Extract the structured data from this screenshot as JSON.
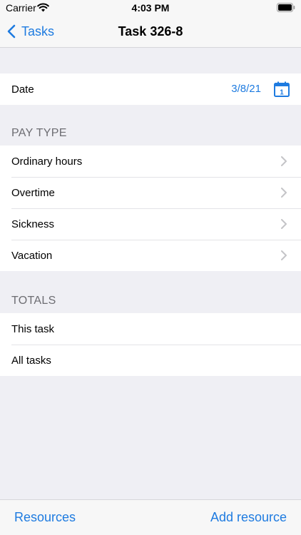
{
  "status_bar": {
    "carrier": "Carrier",
    "time": "4:03 PM"
  },
  "nav": {
    "back_label": "Tasks",
    "title": "Task 326-8"
  },
  "date_row": {
    "label": "Date",
    "value": "3/8/21",
    "calendar_day": "1"
  },
  "pay_type": {
    "header": "PAY TYPE",
    "items": [
      {
        "label": "Ordinary hours"
      },
      {
        "label": "Overtime"
      },
      {
        "label": "Sickness"
      },
      {
        "label": "Vacation"
      }
    ]
  },
  "totals": {
    "header": "TOTALS",
    "items": [
      {
        "label": "This task"
      },
      {
        "label": "All tasks"
      }
    ]
  },
  "toolbar": {
    "left_label": "Resources",
    "right_label": "Add resource"
  },
  "colors": {
    "accent": "#1e7be0",
    "background": "#efeff4",
    "secondary_text": "#6d6d72"
  }
}
